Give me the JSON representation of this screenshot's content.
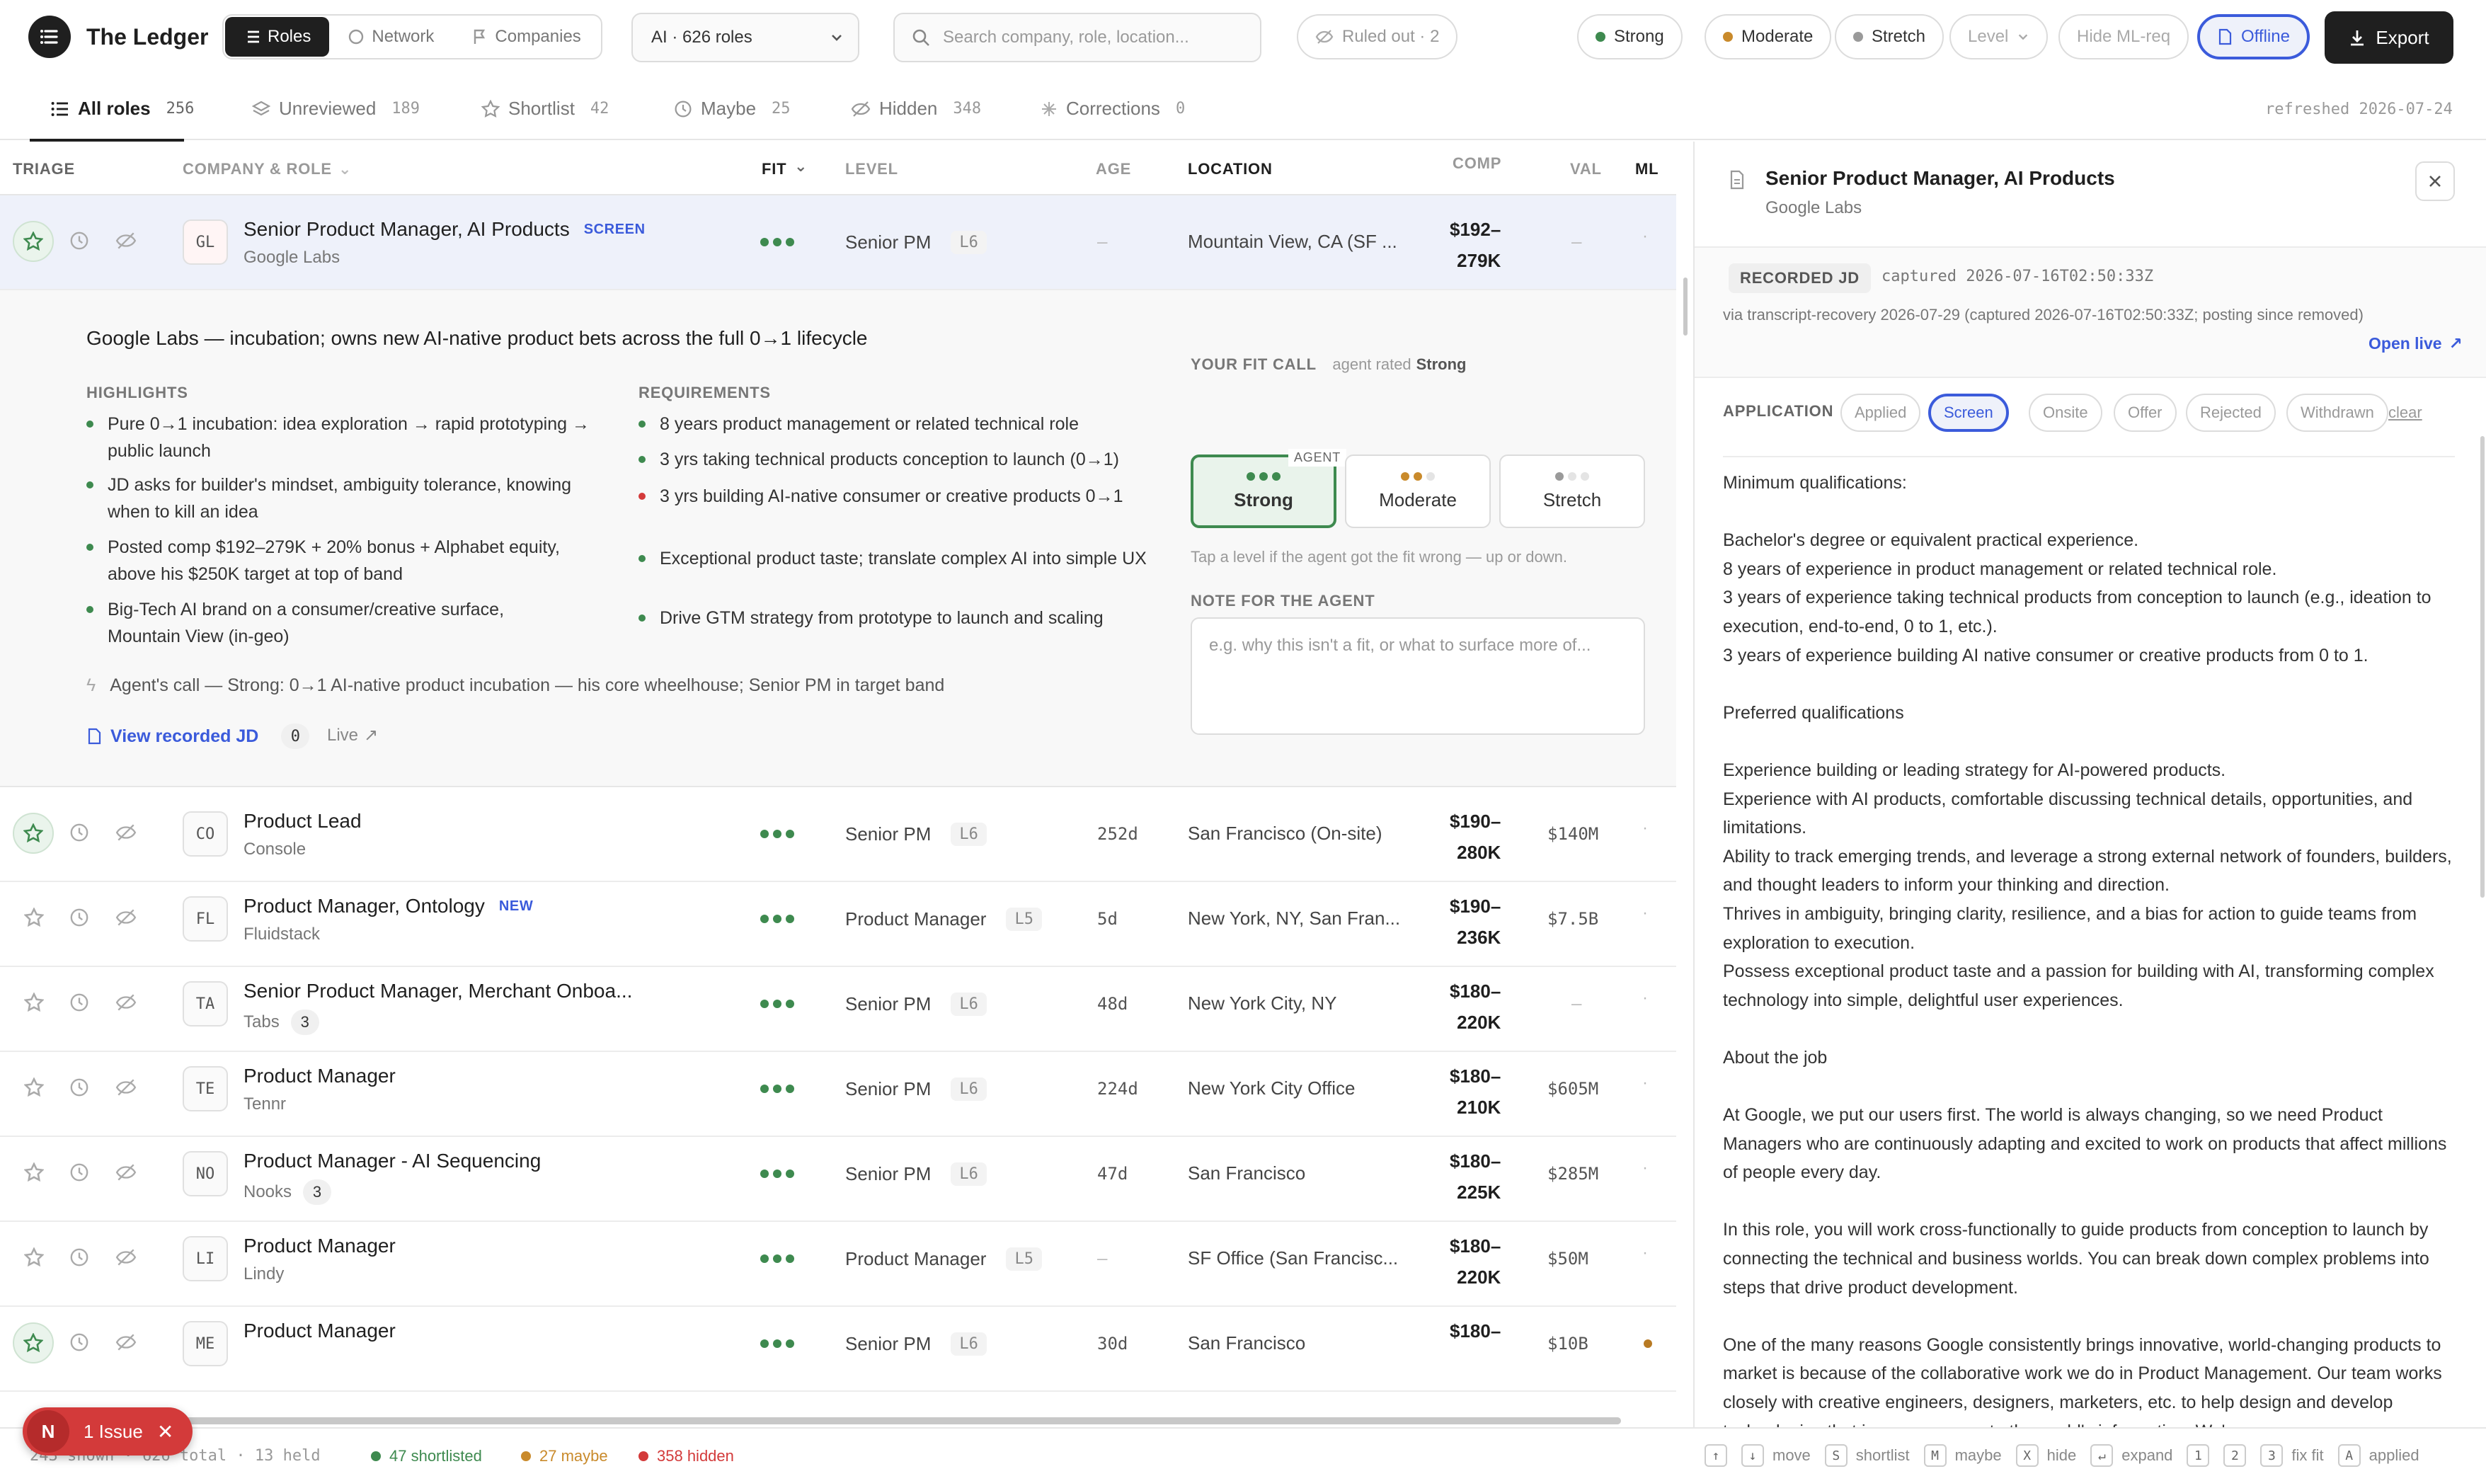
{
  "app": {
    "title": "The Ledger"
  },
  "nav": {
    "roles": "Roles",
    "network": "Network",
    "companies": "Companies"
  },
  "scope": {
    "value": "AI · 626 roles"
  },
  "search": {
    "placeholder": "Search company, role, location..."
  },
  "filters": {
    "ruled_out": "Ruled out · 2",
    "strong": "Strong",
    "moderate": "Moderate",
    "stretch": "Stretch",
    "level": "Level",
    "hide_mlreq": "Hide ML-req",
    "offline": "Offline",
    "export": "Export"
  },
  "colors": {
    "strong": "#3e8a4f",
    "moderate": "#c98a2b",
    "stretch": "#9a9a9a",
    "accent": "#3b5bdb",
    "danger": "#d33a3a"
  },
  "tabs": [
    {
      "label": "All roles",
      "count": "256"
    },
    {
      "label": "Unreviewed",
      "count": "189"
    },
    {
      "label": "Shortlist",
      "count": "42"
    },
    {
      "label": "Maybe",
      "count": "25"
    },
    {
      "label": "Hidden",
      "count": "348"
    },
    {
      "label": "Corrections",
      "count": "0"
    }
  ],
  "refreshed": "refreshed 2026-07-24",
  "columns": {
    "triage": "TRIAGE",
    "company_role": "COMPANY & ROLE",
    "fit": "FIT",
    "level": "LEVEL",
    "age": "AGE",
    "location": "LOCATION",
    "comp": "COMP",
    "val": "VAL",
    "ml": "ML"
  },
  "rows": [
    {
      "initials": "GL",
      "title": "Senior Product Manager, AI Products",
      "badge": "SCREEN",
      "company": "Google Labs",
      "count": "",
      "level": "Senior PM",
      "lv": "L6",
      "age": "—",
      "location": "Mountain View, CA (SF ...",
      "comp1": "$192–",
      "comp2": "279K",
      "val": "—",
      "ml": "·",
      "starred": true
    },
    {
      "initials": "CO",
      "title": "Product Lead",
      "badge": "",
      "company": "Console",
      "count": "",
      "level": "Senior PM",
      "lv": "L6",
      "age": "252d",
      "location": "San Francisco (On-site)",
      "comp1": "$190–",
      "comp2": "280K",
      "val": "$140M",
      "ml": "·",
      "starred": true
    },
    {
      "initials": "FL",
      "title": "Product Manager, Ontology",
      "badge": "NEW",
      "company": "Fluidstack",
      "count": "",
      "level": "Product Manager",
      "lv": "L5",
      "age": "5d",
      "location": "New York, NY, San Fran...",
      "comp1": "$190–",
      "comp2": "236K",
      "val": "$7.5B",
      "ml": "·",
      "starred": false
    },
    {
      "initials": "TA",
      "title": "Senior Product Manager, Merchant Onboa...",
      "badge": "",
      "company": "Tabs",
      "count": "3",
      "level": "Senior PM",
      "lv": "L6",
      "age": "48d",
      "location": "New York City, NY",
      "comp1": "$180–",
      "comp2": "220K",
      "val": "—",
      "ml": "·",
      "starred": false
    },
    {
      "initials": "TE",
      "title": "Product Manager",
      "badge": "",
      "company": "Tennr",
      "count": "",
      "level": "Senior PM",
      "lv": "L6",
      "age": "224d",
      "location": "New York City Office",
      "comp1": "$180–",
      "comp2": "210K",
      "val": "$605M",
      "ml": "·",
      "starred": false
    },
    {
      "initials": "NO",
      "title": "Product Manager - AI Sequencing",
      "badge": "",
      "company": "Nooks",
      "count": "3",
      "level": "Senior PM",
      "lv": "L6",
      "age": "47d",
      "location": "San Francisco",
      "comp1": "$180–",
      "comp2": "225K",
      "val": "$285M",
      "ml": "·",
      "starred": false
    },
    {
      "initials": "LI",
      "title": "Product Manager",
      "badge": "",
      "company": "Lindy",
      "count": "",
      "level": "Product Manager",
      "lv": "L5",
      "age": "—",
      "location": "SF Office (San Francisc...",
      "comp1": "$180–",
      "comp2": "220K",
      "val": "$50M",
      "ml": "·",
      "starred": false
    },
    {
      "initials": "ME",
      "title": "Product Manager",
      "badge": "",
      "company": "",
      "count": "",
      "level": "Senior PM",
      "lv": "L6",
      "age": "30d",
      "location": "San Francisco",
      "comp1": "$180–",
      "comp2": "",
      "val": "$10B",
      "ml": "",
      "starred": true
    }
  ],
  "expanded": {
    "headline": "Google Labs — incubation; owns new AI-native product bets across the full 0→1 lifecycle",
    "highlights_label": "HIGHLIGHTS",
    "highlights": [
      "Pure 0→1 incubation: idea exploration → rapid prototyping → public launch",
      "JD asks for builder's mindset, ambiguity tolerance, knowing when to kill an idea",
      "Posted comp $192–279K + 20% bonus + Alphabet equity, above his $250K target at top of band",
      "Big-Tech AI brand on a consumer/creative surface, Mountain View (in-geo)"
    ],
    "requirements_label": "REQUIREMENTS",
    "requirements": [
      "8 years product management or related technical role",
      "3 yrs taking technical products conception to launch (0→1)",
      "3 yrs building AI-native consumer or creative products 0→1",
      "Exceptional product taste; translate complex AI into simple UX",
      "Drive GTM strategy from prototype to launch and scaling"
    ],
    "agent_call": "Agent's call — Strong: 0→1 AI-native product incubation — his core wheelhouse; Senior PM in target band",
    "view_jd": "View recorded JD",
    "jd_count": "0",
    "live": "Live",
    "fit_label": "YOUR FIT CALL",
    "agent_rated": "agent rated",
    "agent_rating": "Strong",
    "agent_tag": "AGENT",
    "fit_options": [
      "Strong",
      "Moderate",
      "Stretch"
    ],
    "fit_hint": "Tap a level if the agent got the fit wrong — up or down.",
    "note_label": "NOTE FOR THE AGENT",
    "note_placeholder": "e.g. why this isn't a fit, or what to surface more of..."
  },
  "detail": {
    "title": "Senior Product Manager, AI Products",
    "company": "Google Labs",
    "recorded_jd": "RECORDED JD",
    "captured": "captured 2026-07-16T02:50:33Z",
    "via": "via transcript-recovery 2026-07-29 (captured 2026-07-16T02:50:33Z; posting since removed)",
    "open_live": "Open live",
    "application_label": "APPLICATION",
    "application_stages": [
      "Applied",
      "Screen",
      "Onsite",
      "Offer",
      "Rejected",
      "Withdrawn"
    ],
    "clear": "clear",
    "jd_text": "Minimum qualifications:\n\nBachelor's degree or equivalent practical experience.\n8 years of experience in product management or related technical role.\n3 years of experience taking technical products from conception to launch (e.g., ideation to execution, end-to-end, 0 to 1, etc.).\n3 years of experience building AI native consumer or creative products from 0 to 1.\n\nPreferred qualifications\n\nExperience building or leading strategy for AI-powered products.\nExperience with AI products, comfortable discussing technical details, opportunities, and limitations.\nAbility to track emerging trends, and leverage a strong external network of founders, builders, and thought leaders to inform your thinking and direction.\nThrives in ambiguity, bringing clarity, resilience, and a bias for action to guide teams from exploration to execution.\nPossess exceptional product taste and a passion for building with AI, transforming complex technology into simple, delightful user experiences.\n\nAbout the job\n\nAt Google, we put our users first. The world is always changing, so we need Product Managers who are continuously adapting and excited to work on products that affect millions of people every day.\n\nIn this role, you will work cross-functionally to guide products from conception to launch by connecting the technical and business worlds. You can break down complex problems into steps that drive product development.\n\nOne of the many reasons Google consistently brings innovative, world-changing products to market is because of the collaborative work we do in Product Management. Our team works closely with creative engineers, designers, marketers, etc. to help design and develop technologies that improve access to the world's information. We're"
  },
  "status": {
    "shown": "243 shown · 626 total · 13 held",
    "shortlisted": "47 shortlisted",
    "maybe": "27 maybe",
    "hidden": "358 hidden",
    "issue_initial": "N",
    "issue": "1 Issue",
    "shortcuts": [
      {
        "key": "↑",
        "label": ""
      },
      {
        "key": "↓",
        "label": "move"
      },
      {
        "key": "S",
        "label": "shortlist"
      },
      {
        "key": "M",
        "label": "maybe"
      },
      {
        "key": "X",
        "label": "hide"
      },
      {
        "key": "↵",
        "label": "expand"
      },
      {
        "key": "1",
        "label": ""
      },
      {
        "key": "2",
        "label": ""
      },
      {
        "key": "3",
        "label": "fix fit"
      },
      {
        "key": "A",
        "label": "applied"
      }
    ]
  }
}
